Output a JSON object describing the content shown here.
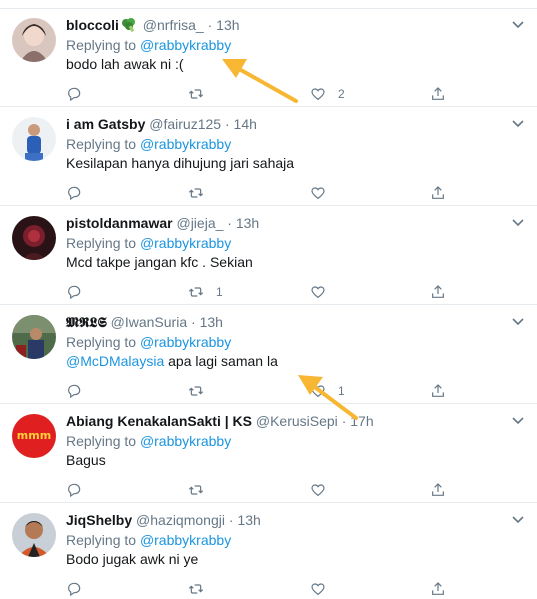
{
  "colors": {
    "accent": "#1b95e0",
    "muted": "#657786",
    "divider": "#e6ecf0",
    "annotation_arrow": "#f7b733"
  },
  "replying_prefix": "Replying to",
  "tweets": [
    {
      "display_name": "bloccoli",
      "emoji": "broccoli-emoji",
      "handle": "@nrfrisa_",
      "dot": "·",
      "time": "13h",
      "replying_to": "@rabbykrabby",
      "text_mention": "",
      "text": "bodo lah awak ni :(",
      "reply_count": "",
      "retweet_count": "",
      "like_count": "2"
    },
    {
      "display_name": "i am Gatsby",
      "emoji": "",
      "handle": "@fairuz125",
      "dot": "·",
      "time": "14h",
      "replying_to": "@rabbykrabby",
      "text_mention": "",
      "text": "Kesilapan hanya dihujung jari sahaja",
      "reply_count": "",
      "retweet_count": "",
      "like_count": ""
    },
    {
      "display_name": "pistoldanmawar",
      "emoji": "",
      "handle": "@jieja_",
      "dot": "·",
      "time": "13h",
      "replying_to": "@rabbykrabby",
      "text_mention": "",
      "text": "Mcd takpe jangan kfc . Sekian",
      "reply_count": "",
      "retweet_count": "1",
      "like_count": ""
    },
    {
      "display_name": "𝕸𝕽𝕷𝕾",
      "emoji": "",
      "handle": "@IwanSuria",
      "dot": "·",
      "time": "13h",
      "replying_to": "@rabbykrabby",
      "text_mention": "@McDMalaysia",
      "text": " apa lagi saman la",
      "reply_count": "",
      "retweet_count": "",
      "like_count": "1"
    },
    {
      "display_name": "Abiang KenakalanSakti | KS",
      "emoji": "",
      "handle": "@KerusiSepi",
      "dot": "·",
      "time": "17h",
      "replying_to": "@rabbykrabby",
      "text_mention": "",
      "text": "Bagus",
      "reply_count": "",
      "retweet_count": "",
      "like_count": ""
    },
    {
      "display_name": "JiqShelby",
      "emoji": "",
      "handle": "@haziqmongji",
      "dot": "·",
      "time": "13h",
      "replying_to": "@rabbykrabby",
      "text_mention": "",
      "text": "Bodo jugak awk ni ye",
      "reply_count": "",
      "retweet_count": "",
      "like_count": ""
    }
  ]
}
